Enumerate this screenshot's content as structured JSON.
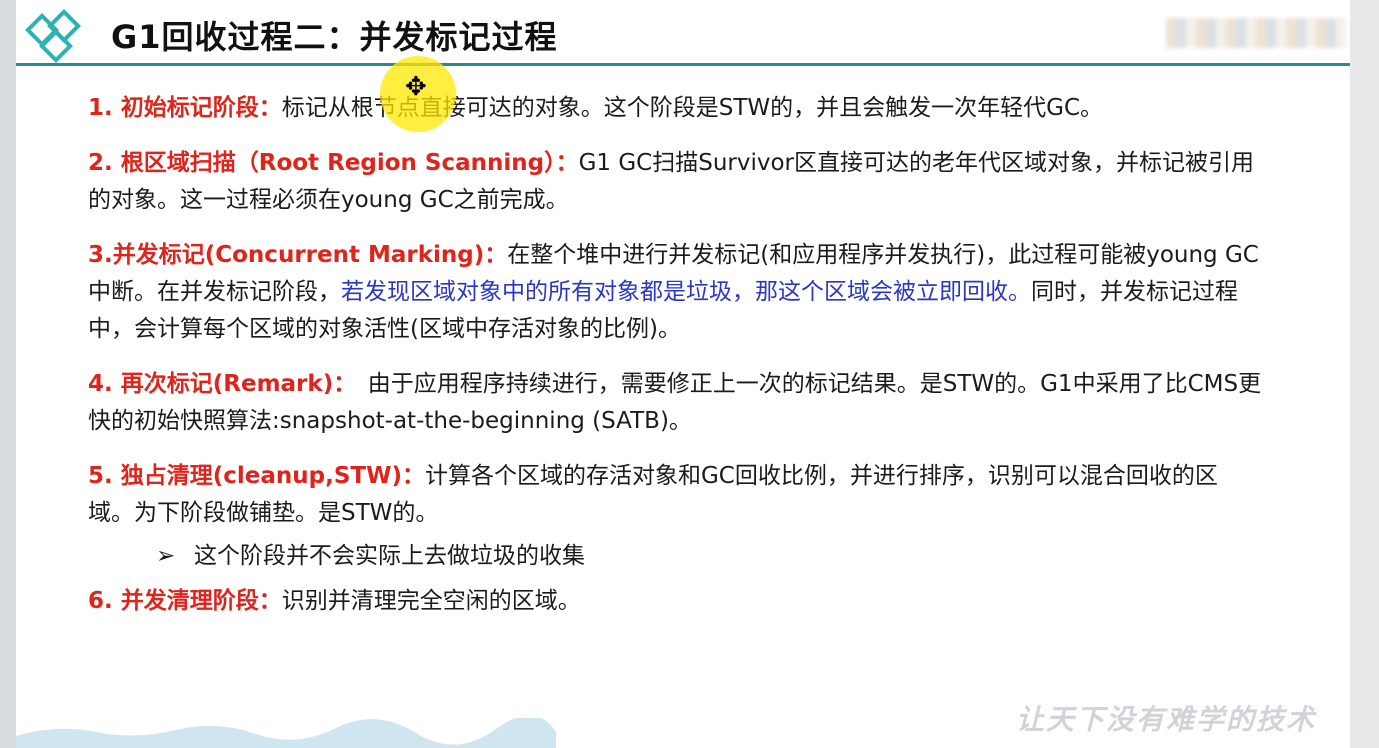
{
  "slide": {
    "title": "G1回收过程二：并发标记过程",
    "watermark": "让天下没有难学的技术"
  },
  "items": [
    {
      "head": "1. 初始标记阶段：",
      "body": "标记从根节点直接可达的对象。这个阶段是STW的，并且会触发一次年轻代GC。"
    },
    {
      "head": "2. 根区域扫描（Root Region Scanning）：",
      "body": "G1 GC扫描Survivor区直接可达的老年代区域对象，并标记被引用的对象。这一过程必须在young GC之前完成。"
    },
    {
      "head": "3.并发标记(Concurrent Marking)：",
      "body_a": "在整个堆中进行并发标记(和应用程序并发执行)，此过程可能被young GC中断。在并发标记阶段，",
      "highlight": "若发现区域对象中的所有对象都是垃圾，那这个区域会被立即回收。",
      "body_b": "同时，并发标记过程中，会计算每个区域的对象活性(区域中存活对象的比例)。"
    },
    {
      "head": "4. 再次标记(Remark)：",
      "body": "　由于应用程序持续进行，需要修正上一次的标记结果。是STW的。G1中采用了比CMS更快的初始快照算法:snapshot-at-the-beginning (SATB)。"
    },
    {
      "head": "5. 独占清理(cleanup,STW)：",
      "body": "计算各个区域的存活对象和GC回收比例，并进行排序，识别可以混合回收的区域。为下阶段做铺垫。是STW的。",
      "sub_bullet": "➢",
      "sub": "这个阶段并不会实际上去做垃圾的收集"
    },
    {
      "head": "6. 并发清理阶段：",
      "body": "识别并清理完全空闲的区域。"
    }
  ],
  "colors": {
    "heading_red": "#e0241b",
    "highlight_blue": "#2a36c8",
    "title_rule": "#2a8a8e",
    "logo_teal": "#2bb3b1"
  }
}
